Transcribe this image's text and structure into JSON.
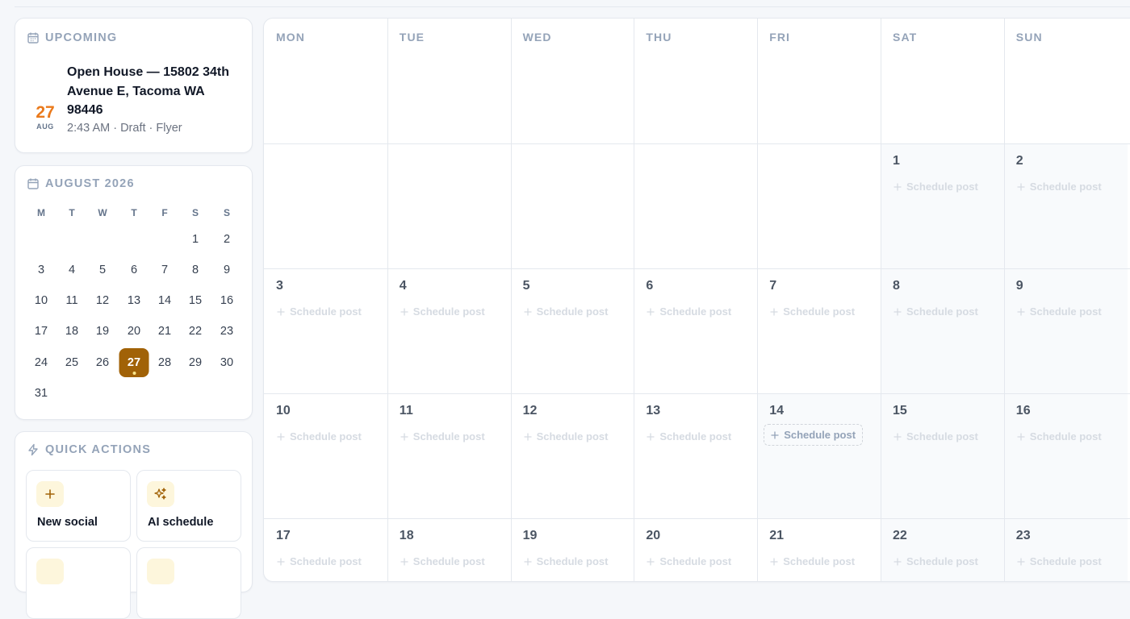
{
  "upcoming": {
    "header": "UPCOMING",
    "event": {
      "day": "27",
      "month": "AUG",
      "title": "Open House — 15802 34th Avenue E, Tacoma WA 98446",
      "meta": "2:43 AM · Draft · Flyer"
    }
  },
  "mini_calendar": {
    "header": "AUGUST 2026",
    "weekdays": [
      "M",
      "T",
      "W",
      "T",
      "F",
      "S",
      "S"
    ],
    "first_weekday_index": 5,
    "days_in_month": 31,
    "selected_day": 27,
    "selected_color": "#a16207"
  },
  "quick_actions": {
    "header": "QUICK ACTIONS",
    "items": [
      {
        "label": "New social",
        "icon": "plus-icon"
      },
      {
        "label": "AI schedule",
        "icon": "sparkles-icon"
      }
    ]
  },
  "calendar": {
    "columns": [
      "MON",
      "TUE",
      "WED",
      "THU",
      "FRI",
      "SAT",
      "SUN"
    ],
    "schedule_label": "Schedule post",
    "highlighted_day": 14,
    "weeks": [
      [
        null,
        null,
        null,
        null,
        null,
        null,
        null
      ],
      [
        null,
        null,
        null,
        null,
        null,
        1,
        2
      ],
      [
        3,
        4,
        5,
        6,
        7,
        8,
        9
      ],
      [
        10,
        11,
        12,
        13,
        14,
        15,
        16
      ],
      [
        17,
        18,
        19,
        20,
        21,
        22,
        23
      ]
    ]
  },
  "colors": {
    "accent": "#a16207",
    "event_date": "#ea7a1c",
    "icon_bg": "#fdf6dc"
  }
}
